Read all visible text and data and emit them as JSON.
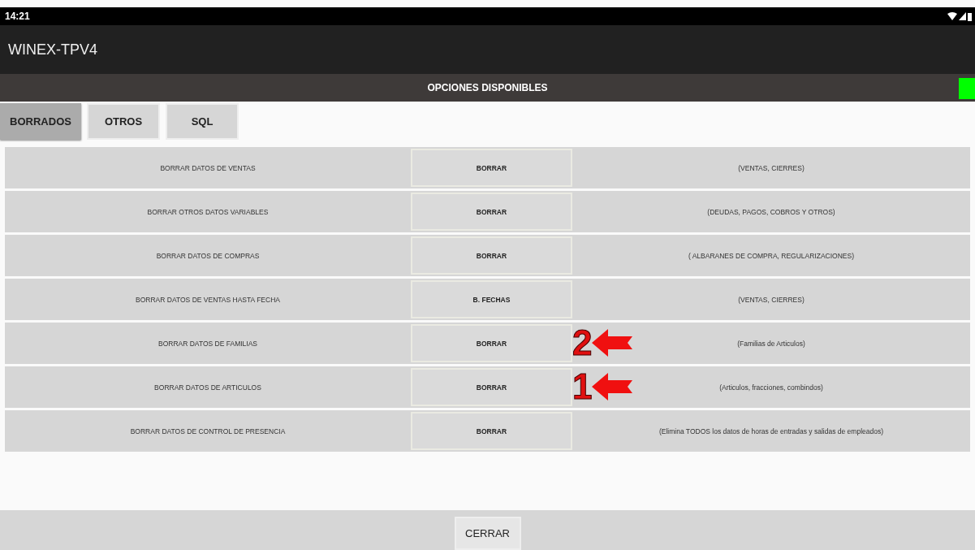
{
  "status_bar": {
    "time": "14:21"
  },
  "app_bar": {
    "title": "WINEX-TPV4"
  },
  "header": {
    "title": "OPCIONES DISPONIBLES",
    "indicator_on": true
  },
  "tabs": [
    {
      "label": "BORRADOS",
      "selected": true
    },
    {
      "label": "OTROS",
      "selected": false
    },
    {
      "label": "SQL",
      "selected": false
    }
  ],
  "rows": [
    {
      "label": "BORRAR DATOS DE VENTAS",
      "button": "BORRAR",
      "description": "(VENTAS, CIERRES)"
    },
    {
      "label": "BORRAR OTROS DATOS VARIABLES",
      "button": "BORRAR",
      "description": "(DEUDAS, PAGOS, COBROS Y OTROS)"
    },
    {
      "label": "BORRAR DATOS DE COMPRAS",
      "button": "BORRAR",
      "description": "( ALBARANES DE COMPRA, REGULARIZACIONES)"
    },
    {
      "label": "BORRAR DATOS DE VENTAS HASTA FECHA",
      "button": "B. FECHAS",
      "description": "(VENTAS, CIERRES)"
    },
    {
      "label": "BORRAR DATOS DE FAMILIAS",
      "button": "BORRAR",
      "description": "(Familias de Articulos)",
      "annotation": "2"
    },
    {
      "label": "BORRAR DATOS DE ARTICULOS",
      "button": "BORRAR",
      "description": "(Articulos, fracciones, combindos)",
      "annotation": "1"
    },
    {
      "label": "BORRAR DATOS DE CONTROL DE PRESENCIA",
      "button": "BORRAR",
      "description": "(Elimina TODOS los datos de horas de entradas y salidas de empleados)"
    }
  ],
  "footer": {
    "button": "CERRAR"
  }
}
